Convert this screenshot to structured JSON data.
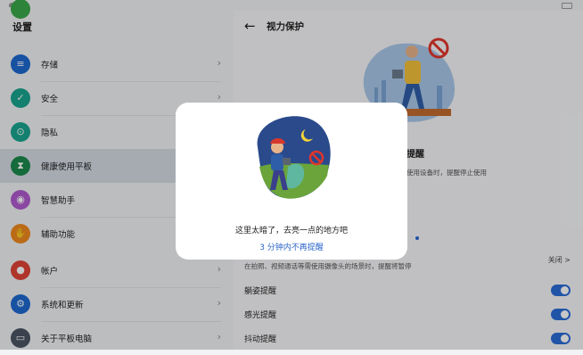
{
  "left_pane": {
    "title": "设置",
    "items": [
      {
        "label": "存储",
        "icon": "storage-icon",
        "color": "#1e68d0"
      },
      {
        "label": "安全",
        "icon": "shield-icon",
        "color": "#1aa58f"
      },
      {
        "label": "隐私",
        "icon": "privacy-icon",
        "color": "#1aa58f"
      },
      {
        "label": "健康使用平板",
        "icon": "hourglass-icon",
        "color": "#1b8a4c"
      },
      {
        "label": "智慧助手",
        "icon": "assistant-icon",
        "color": "#b05ccf"
      },
      {
        "label": "辅助功能",
        "icon": "hand-icon",
        "color": "#f08a1e"
      },
      {
        "label": "帐户",
        "icon": "account-icon",
        "color": "#e04336"
      },
      {
        "label": "系统和更新",
        "icon": "system-icon",
        "color": "#1e68d0"
      },
      {
        "label": "关于平板电脑",
        "icon": "tablet-icon",
        "color": "#4a5563"
      }
    ]
  },
  "right_pane": {
    "title": "视力保护",
    "setting_title_partial": "提醒",
    "setting_desc_partial": "使用设备时，提醒停止使用",
    "close_link": "关闭 >",
    "camera_desc": "在拍照、视频通话等需使用摄像头的场景时，提醒将暂停",
    "toggles": [
      {
        "label": "躺姿提醒"
      },
      {
        "label": "感光提醒"
      },
      {
        "label": "抖动提醒"
      }
    ]
  },
  "dialog": {
    "message": "这里太暗了，去亮一点的地方吧",
    "action": "3 分钟内不再提醒"
  }
}
